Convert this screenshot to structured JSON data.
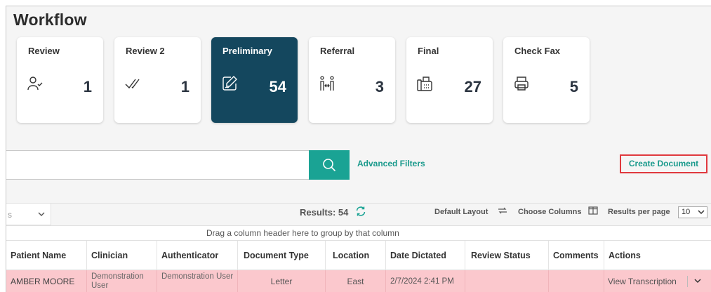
{
  "title": "Workflow",
  "cards": [
    {
      "label": "Review",
      "count": "1",
      "icon": "user-check-icon"
    },
    {
      "label": "Review 2",
      "count": "1",
      "icon": "double-check-icon"
    },
    {
      "label": "Preliminary",
      "count": "54",
      "icon": "edit-document-icon"
    },
    {
      "label": "Referral",
      "count": "3",
      "icon": "referral-icon"
    },
    {
      "label": "Final",
      "count": "27",
      "icon": "fax-machine-icon"
    },
    {
      "label": "Check Fax",
      "count": "5",
      "icon": "printer-icon"
    }
  ],
  "search": {
    "value": "",
    "placeholder": ""
  },
  "advanced_filters": "Advanced Filters",
  "create_document": "Create Document",
  "toolbar": {
    "group_value": "s",
    "results_label": "Results: 54",
    "default_layout": "Default Layout",
    "choose_columns": "Choose Columns",
    "results_per_page_label": "Results per page",
    "results_per_page_value": "10"
  },
  "drag_hint": "Drag a column header here to group by that column",
  "columns": [
    "Patient Name",
    "Clinician",
    "Authenticator",
    "Document Type",
    "Location",
    "Date Dictated",
    "Review Status",
    "Comments",
    "Actions"
  ],
  "row": {
    "patient_name": "AMBER MOORE",
    "clinician": "Demonstration User",
    "authenticator": "Demonstration User",
    "document_type": "Letter",
    "location": "East",
    "date_dictated": "2/7/2024 2:41 PM",
    "review_status": "",
    "comments": "",
    "action": "View Transcription"
  },
  "colors": {
    "active_card": "#14475e",
    "accent_teal": "#1aa394",
    "row_highlight": "#fbc8cd",
    "create_border": "#e0393e"
  }
}
